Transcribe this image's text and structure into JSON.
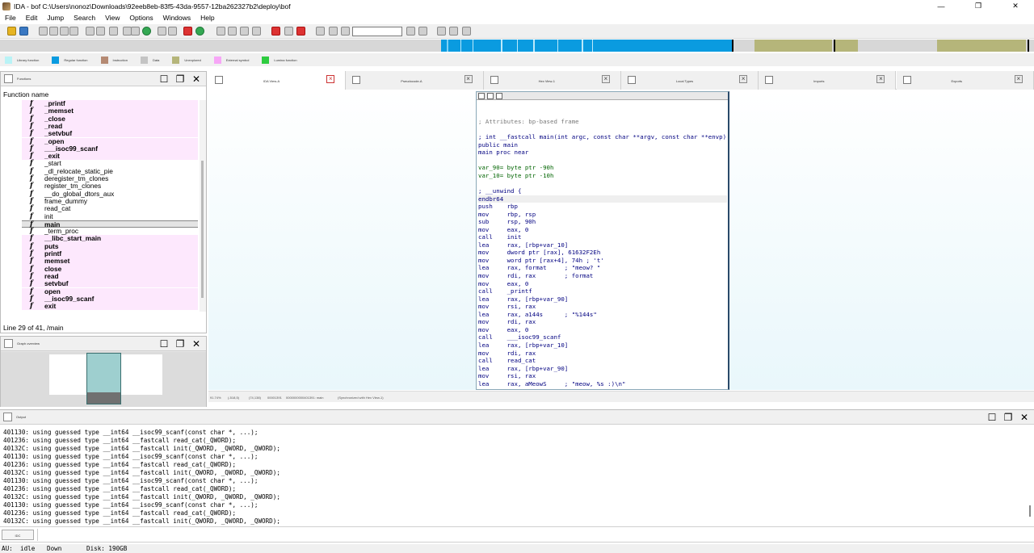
{
  "window": {
    "title": "IDA - bof C:\\Users\\nonoz\\Downloads\\92eeb8eb-83f5-43da-9557-12ba262327b2\\deploy\\bof",
    "minimize": "—",
    "maximize": "❐",
    "close": "✕"
  },
  "menu": [
    "File",
    "Edit",
    "Jump",
    "Search",
    "View",
    "Options",
    "Windows",
    "Help"
  ],
  "legend": [
    {
      "label": "Library function",
      "color": "#b9f3f6"
    },
    {
      "label": "Regular function",
      "color": "#0a9be0"
    },
    {
      "label": "Instruction",
      "color": "#b58a73"
    },
    {
      "label": "Data",
      "color": "#c4c4c4"
    },
    {
      "label": "Unexplored",
      "color": "#b5b57a"
    },
    {
      "label": "External symbol",
      "color": "#f7a7f7"
    },
    {
      "label": "Lumina function",
      "color": "#2ecc40"
    }
  ],
  "functions_panel": {
    "title": "Functions",
    "header": "Function name",
    "status": "Line 29 of 41, /main",
    "items": [
      {
        "name": "_printf",
        "kind": "lib"
      },
      {
        "name": "_memset",
        "kind": "lib"
      },
      {
        "name": "_close",
        "kind": "lib"
      },
      {
        "name": "_read",
        "kind": "lib"
      },
      {
        "name": "_setvbuf",
        "kind": "lib"
      },
      {
        "name": "_open",
        "kind": "lib"
      },
      {
        "name": "___isoc99_scanf",
        "kind": "lib"
      },
      {
        "name": "_exit",
        "kind": "lib"
      },
      {
        "name": "_start",
        "kind": "reg"
      },
      {
        "name": "_dl_relocate_static_pie",
        "kind": "reg"
      },
      {
        "name": "deregister_tm_clones",
        "kind": "reg"
      },
      {
        "name": "register_tm_clones",
        "kind": "reg"
      },
      {
        "name": "__do_global_dtors_aux",
        "kind": "reg"
      },
      {
        "name": "frame_dummy",
        "kind": "reg"
      },
      {
        "name": "read_cat",
        "kind": "reg"
      },
      {
        "name": "init",
        "kind": "reg"
      },
      {
        "name": "main",
        "kind": "sel"
      },
      {
        "name": "_term_proc",
        "kind": "reg"
      },
      {
        "name": "__libc_start_main",
        "kind": "lib"
      },
      {
        "name": "puts",
        "kind": "lib"
      },
      {
        "name": "printf",
        "kind": "lib"
      },
      {
        "name": "memset",
        "kind": "lib"
      },
      {
        "name": "close",
        "kind": "lib"
      },
      {
        "name": "read",
        "kind": "lib"
      },
      {
        "name": "setvbuf",
        "kind": "lib"
      },
      {
        "name": "open",
        "kind": "lib"
      },
      {
        "name": "__isoc99_scanf",
        "kind": "lib"
      },
      {
        "name": "exit",
        "kind": "lib"
      }
    ]
  },
  "overview_panel": {
    "title": "Graph overview"
  },
  "tabs": [
    {
      "label": "IDA View-A",
      "active": true
    },
    {
      "label": "Pseudocode-A",
      "active": false
    },
    {
      "label": "Hex View-1",
      "active": false
    },
    {
      "label": "Local Types",
      "active": false
    },
    {
      "label": "Imports",
      "active": false
    },
    {
      "label": "Exports",
      "active": false
    }
  ],
  "disasm": [
    {
      "t": "; Attributes: bp-based frame",
      "c": "cmt"
    },
    {
      "t": "",
      "c": ""
    },
    {
      "t": "; int __fastcall main(int argc, const char **argv, const char **envp)",
      "c": ""
    },
    {
      "t": "public main",
      "c": ""
    },
    {
      "t": "main proc near",
      "c": ""
    },
    {
      "t": "",
      "c": ""
    },
    {
      "t": "var_90= byte ptr -90h",
      "c": "g"
    },
    {
      "t": "var_10= byte ptr -10h",
      "c": "g"
    },
    {
      "t": "",
      "c": ""
    },
    {
      "t": "; __unwind {",
      "c": ""
    },
    {
      "t": "endbr64",
      "c": "hl"
    },
    {
      "t": "push    rbp",
      "c": ""
    },
    {
      "t": "mov     rbp, rsp",
      "c": ""
    },
    {
      "t": "sub     rsp, 90h",
      "c": ""
    },
    {
      "t": "mov     eax, 0",
      "c": ""
    },
    {
      "t": "call    init",
      "c": ""
    },
    {
      "t": "lea     rax, [rbp+var_10]",
      "c": ""
    },
    {
      "t": "mov     dword ptr [rax], 61632F2Eh",
      "c": ""
    },
    {
      "t": "mov     word ptr [rax+4], 74h ; 't'",
      "c": ""
    },
    {
      "t": "lea     rax, format     ; \"meow? \"",
      "c": ""
    },
    {
      "t": "mov     rdi, rax        ; format",
      "c": ""
    },
    {
      "t": "mov     eax, 0",
      "c": ""
    },
    {
      "t": "call    _printf",
      "c": ""
    },
    {
      "t": "lea     rax, [rbp+var_90]",
      "c": ""
    },
    {
      "t": "mov     rsi, rax",
      "c": ""
    },
    {
      "t": "lea     rax, a144s      ; \"%144s\"",
      "c": ""
    },
    {
      "t": "mov     rdi, rax",
      "c": ""
    },
    {
      "t": "mov     eax, 0",
      "c": ""
    },
    {
      "t": "call    ___isoc99_scanf",
      "c": ""
    },
    {
      "t": "lea     rax, [rbp+var_10]",
      "c": ""
    },
    {
      "t": "mov     rdi, rax",
      "c": ""
    },
    {
      "t": "call    read_cat",
      "c": ""
    },
    {
      "t": "lea     rax, [rbp+var_90]",
      "c": ""
    },
    {
      "t": "mov     rsi, rax",
      "c": ""
    },
    {
      "t": "lea     rax, aMeowS     ; \"meow, %s :)\\n\"",
      "c": ""
    }
  ],
  "graph_status": {
    "zoom": "91.74%",
    "pos1": "(-518,5)",
    "pos2": "(74,138)",
    "offset": "00001391",
    "address": "0000000000401391: main",
    "sync": "(Synchronized with Hex View-1)"
  },
  "output_panel": {
    "title": "Output",
    "lines": [
      "401130: using guessed type __int64 __isoc99_scanf(const char *, ...);",
      "401236: using guessed type __int64 __fastcall read_cat(_QWORD);",
      "40132C: using guessed type __int64 __fastcall init(_QWORD, _QWORD, _QWORD);",
      "401130: using guessed type __int64 __isoc99_scanf(const char *, ...);",
      "401236: using guessed type __int64 __fastcall read_cat(_QWORD);",
      "40132C: using guessed type __int64 __fastcall init(_QWORD, _QWORD, _QWORD);",
      "401130: using guessed type __int64 __isoc99_scanf(const char *, ...);",
      "401236: using guessed type __int64 __fastcall read_cat(_QWORD);",
      "40132C: using guessed type __int64 __fastcall init(_QWORD, _QWORD, _QWORD);",
      "401130: using guessed type __int64 __isoc99_scanf(const char *, ...);",
      "401236: using guessed type __int64 __fastcall read_cat(_QWORD);",
      "40132C: using guessed type __int64 __fastcall init(_QWORD, _QWORD, _QWORD);"
    ]
  },
  "command": {
    "button": "IDC",
    "value": ""
  },
  "status": {
    "au_label": "AU:",
    "au_value": "idle",
    "direction": "Down",
    "disk": "Disk: 190GB"
  },
  "colors": {
    "lib_row": "#fde8fd",
    "regular": "#0a9be0",
    "unexplored": "#b5b57a"
  }
}
